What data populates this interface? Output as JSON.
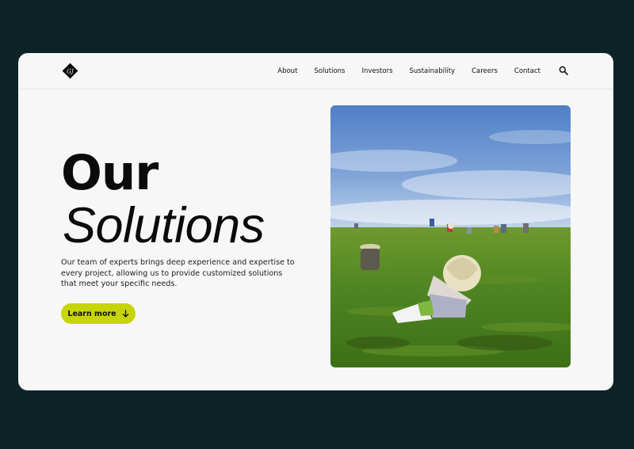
{
  "brand": {
    "logo_text": "GJ"
  },
  "nav": {
    "items": [
      {
        "label": "About"
      },
      {
        "label": "Solutions"
      },
      {
        "label": "Investors"
      },
      {
        "label": "Sustainability"
      },
      {
        "label": "Careers"
      },
      {
        "label": "Contact"
      }
    ],
    "search_icon": "search-icon"
  },
  "hero": {
    "title_line1": "Our",
    "title_line2": "Solutions",
    "description": "Our team of experts brings deep experience and expertise to every project, allowing us to provide customized solutions that meet your specific needs.",
    "cta_label": "Learn more",
    "cta_icon": "arrow-down-icon",
    "image_subject": "tea-plantation-photo"
  },
  "colors": {
    "background": "#0d2325",
    "card": "#f7f7f7",
    "accent": "#c8d40a",
    "text": "#0b0b0b"
  }
}
